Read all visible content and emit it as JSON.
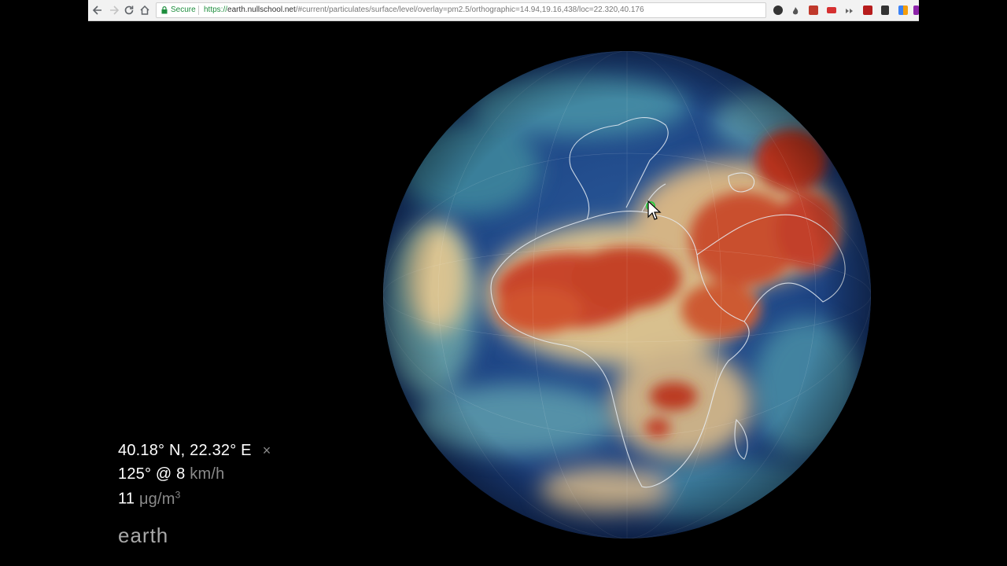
{
  "browser": {
    "security_label": "Secure",
    "url_scheme": "https://",
    "url_host": "earth.nullschool.net",
    "url_path": "/#current/particulates/surface/level/overlay=pm2.5/orthographic=14.94,19.16,438/loc=22.320,40.176",
    "extension_icons": [
      "dark-circle-icon",
      "flame-icon",
      "red-square-icon",
      "red-dots-icon",
      "arrows-icon",
      "red-book-icon",
      "puzzle-icon",
      "color-grid-icon",
      "purple-icon"
    ]
  },
  "readout": {
    "location": "40.18° N, 22.32° E",
    "close_symbol": "×",
    "wind_value": "125° @ 8",
    "wind_unit": "km/h",
    "pm_value": "11",
    "pm_unit": "μg/m",
    "pm_unit_exp": "3"
  },
  "app_title": "earth",
  "colors": {
    "background": "#000000",
    "low_particulates": "#1a3a7a",
    "mid_particulates": "#d9c28a",
    "high_particulates": "#c0361e",
    "marker": "#2ecc40",
    "coastline": "#e8eef5"
  }
}
